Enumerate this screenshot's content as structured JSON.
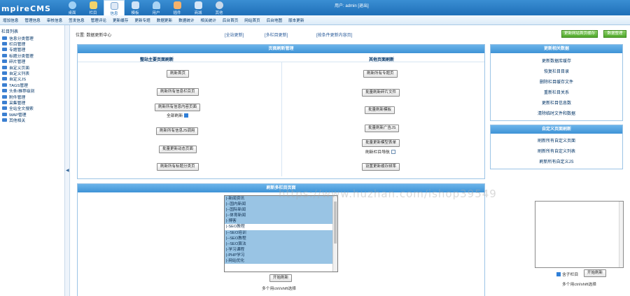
{
  "header": {
    "logo": "mpireCMS",
    "nav": [
      {
        "label": "桌面",
        "icon": "desktop-icon",
        "color": "#9fd0f5"
      },
      {
        "label": "栏目",
        "icon": "edit-icon",
        "color": "#f2d36b"
      },
      {
        "label": "信息",
        "icon": "info-icon",
        "color": "#dfe9f6"
      },
      {
        "label": "模板",
        "icon": "template-icon",
        "color": "#cfe3f7"
      },
      {
        "label": "用户",
        "icon": "user-icon",
        "color": "#a9d4f4"
      },
      {
        "label": "插件",
        "icon": "plugin-icon",
        "color": "#f6b26b"
      },
      {
        "label": "商城",
        "icon": "shop-icon",
        "color": "#d5e6f7"
      },
      {
        "label": "其他",
        "icon": "gear-icon",
        "color": "#c9d9ea"
      }
    ],
    "user_info": "用户: admin [退出]"
  },
  "subnav": [
    "增加信息",
    "管理信息",
    "审核信息",
    "签发信息",
    "管理评论",
    "更新缓存",
    "更新专题",
    "数据更新",
    "数据统计",
    "相关统计",
    "后台首页",
    "网站首页",
    "后台地图",
    "版本更新"
  ],
  "sidebar": {
    "root": "栏目列表",
    "items": [
      "信息分类管理",
      "栏目管理",
      "专题管理",
      "标题分类管理",
      "碎片管理",
      "自定义页面",
      "自定义列表",
      "自定义JS",
      "TAGS管理",
      "头条/推荐级别",
      "附件管理",
      "采集管理",
      "全站全文搜索",
      "WAP管理",
      "其他相关"
    ],
    "collapse": "◀"
  },
  "location": "位置: 数据更新中心",
  "toplinks": [
    "[全站更新]",
    "[多栏目更新]",
    "[按条件更新内容页]"
  ],
  "top_buttons": {
    "speed_update": "更新网站首页缓存",
    "refresh": "数据整理"
  },
  "refresh_panel": {
    "title": "页面刷新管理",
    "left_head": "整站主要页面刷新",
    "right_head": "其他页面刷新",
    "left_buttons": [
      "刷新首页",
      "刷新所有信息栏目页",
      "刷新所有信息内容页面",
      "刷新所有信息JS调用",
      "批量更新动态页面",
      "刷新所有标题分类页"
    ],
    "all_refresh_label": "全部刷新",
    "right_buttons": [
      "刷新所有专题页",
      "批量刷新碎片文件",
      "批量刷新模板",
      "批量刷新广告JS",
      "批量更新模型表单"
    ],
    "refresh_column_label": "刷新栏目导航",
    "right_last_button": "设置更新缓存频率"
  },
  "cache_panel": {
    "title": "更新相关数据",
    "links": [
      "更新数据库缓存",
      "恢复栏目目录",
      "删除栏目缓存文件",
      "重新栏目关系",
      "更新栏目信息数",
      "清除临时文件和数据"
    ]
  },
  "custom_panel": {
    "title": "自定义页面刷新",
    "links": [
      "刷新所有自定义页面",
      "刷新所有自定义列表",
      "刷新所有自定义JS"
    ]
  },
  "multi_panel": {
    "title": "刷新多栏目页面",
    "options": [
      {
        "text": "|-新闻资讯",
        "selected": true
      },
      {
        "text": "|--国内新闻",
        "selected": true
      },
      {
        "text": "|--国际新闻",
        "selected": true
      },
      {
        "text": "|--体育新闻",
        "selected": true
      },
      {
        "text": "|-博客",
        "selected": true
      },
      {
        "text": "|-SEO教程",
        "selected": false
      },
      {
        "text": "|--SEO培训",
        "selected": true
      },
      {
        "text": "|--SEO教程",
        "selected": true
      },
      {
        "text": "|--SEO算法",
        "selected": true
      },
      {
        "text": "|-学习课程",
        "selected": true
      },
      {
        "text": "|-PHP学习",
        "selected": true
      },
      {
        "text": "|-网站优化",
        "selected": true
      }
    ],
    "start_button": "开始刷新",
    "hint": "多个用ctrl/shift选择"
  },
  "side_textarea": {
    "include_label": "含子栏目",
    "start_button": "开始刷新",
    "hint": "多个用ctrl/shift选择"
  },
  "watermark": "https://www.huzhan.com/ishop39549"
}
